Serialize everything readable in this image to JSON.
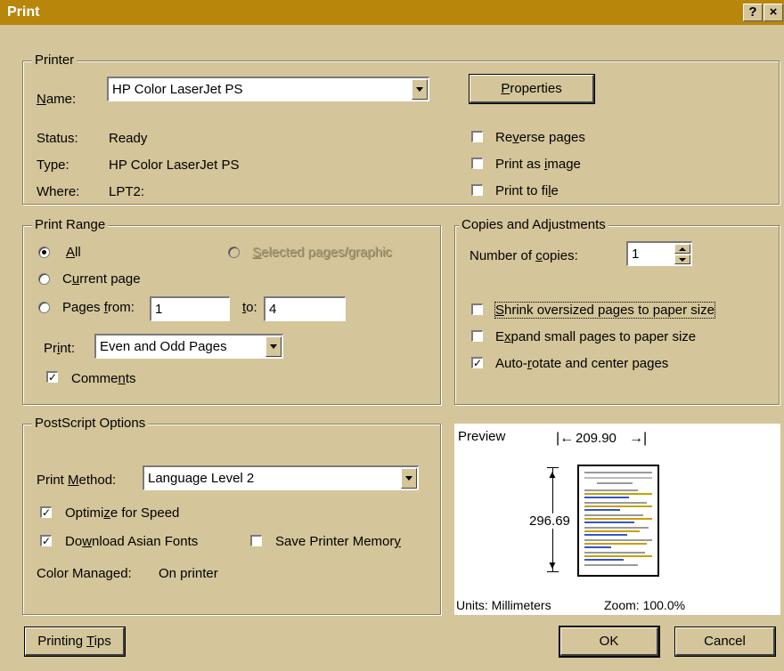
{
  "window": {
    "title": "Print",
    "help_label": "?",
    "close_label": "×"
  },
  "printer": {
    "legend": "Printer",
    "name_label_pre": "",
    "name_label_u": "N",
    "name_label_post": "ame:",
    "name_value": "HP Color LaserJet PS",
    "properties_u": "P",
    "properties_post": "roperties",
    "status_label": "Status:",
    "status_value": "Ready",
    "type_label": "Type:",
    "type_value": "HP Color LaserJet PS",
    "where_label": "Where:",
    "where_value": "LPT2:",
    "reverse_pre": "Re",
    "reverse_u": "v",
    "reverse_post": "erse pages",
    "reverse_checked": false,
    "image_pre": "Print as ",
    "image_u": "i",
    "image_post": "mage",
    "image_checked": false,
    "file_pre": "Print to fi",
    "file_u": "l",
    "file_post": "e",
    "file_checked": false
  },
  "range": {
    "legend": "Print Range",
    "all_u": "A",
    "all_post": "ll",
    "all_selected": true,
    "selected_u": "S",
    "selected_post": "elected pages/graphic",
    "current_pre": "C",
    "current_u": "u",
    "current_post": "rrent page",
    "pages_pre": "Pages ",
    "pages_u": "f",
    "pages_post": "rom:",
    "from_value": "1",
    "to_u": "t",
    "to_post": "o:",
    "to_value": "4",
    "print_pre": "Pr",
    "print_u": "i",
    "print_post": "nt:",
    "print_value": "Even and Odd Pages",
    "comments_pre": "Comme",
    "comments_u": "n",
    "comments_post": "ts",
    "comments_checked": true
  },
  "copies": {
    "legend": "Copies and Adjustments",
    "num_pre": "Number of ",
    "num_u": "c",
    "num_post": "opies:",
    "num_value": "1",
    "shrink_u": "S",
    "shrink_post": "hrink oversized pages to paper size",
    "shrink_checked": false,
    "expand_pre": "E",
    "expand_u": "x",
    "expand_post": "pand small pages to paper size",
    "expand_checked": false,
    "auto_pre": "Auto-",
    "auto_u": "r",
    "auto_post": "otate and center pages",
    "auto_checked": true
  },
  "postscript": {
    "legend": "PostScript Options",
    "method_pre": "Print ",
    "method_u": "M",
    "method_post": "ethod:",
    "method_value": "Language Level 2",
    "optimize_pre": "Optimi",
    "optimize_u": "z",
    "optimize_post": "e for Speed",
    "optimize_checked": true,
    "asian_pre": "Do",
    "asian_u": "w",
    "asian_post": "nload Asian Fonts",
    "asian_checked": true,
    "save_pre": "Save Printer Memor",
    "save_u": "y",
    "save_post": "",
    "save_checked": false,
    "color_label": "Color Managed:",
    "color_value": "On printer"
  },
  "preview": {
    "label": "Preview",
    "width_value": "209.90",
    "height_value": "296.69",
    "units": "Units: Millimeters",
    "zoom": "Zoom: 100.0%"
  },
  "buttons": {
    "tips_pre": "Printing ",
    "tips_u": "T",
    "tips_post": "ips",
    "ok": "OK",
    "cancel": "Cancel"
  }
}
